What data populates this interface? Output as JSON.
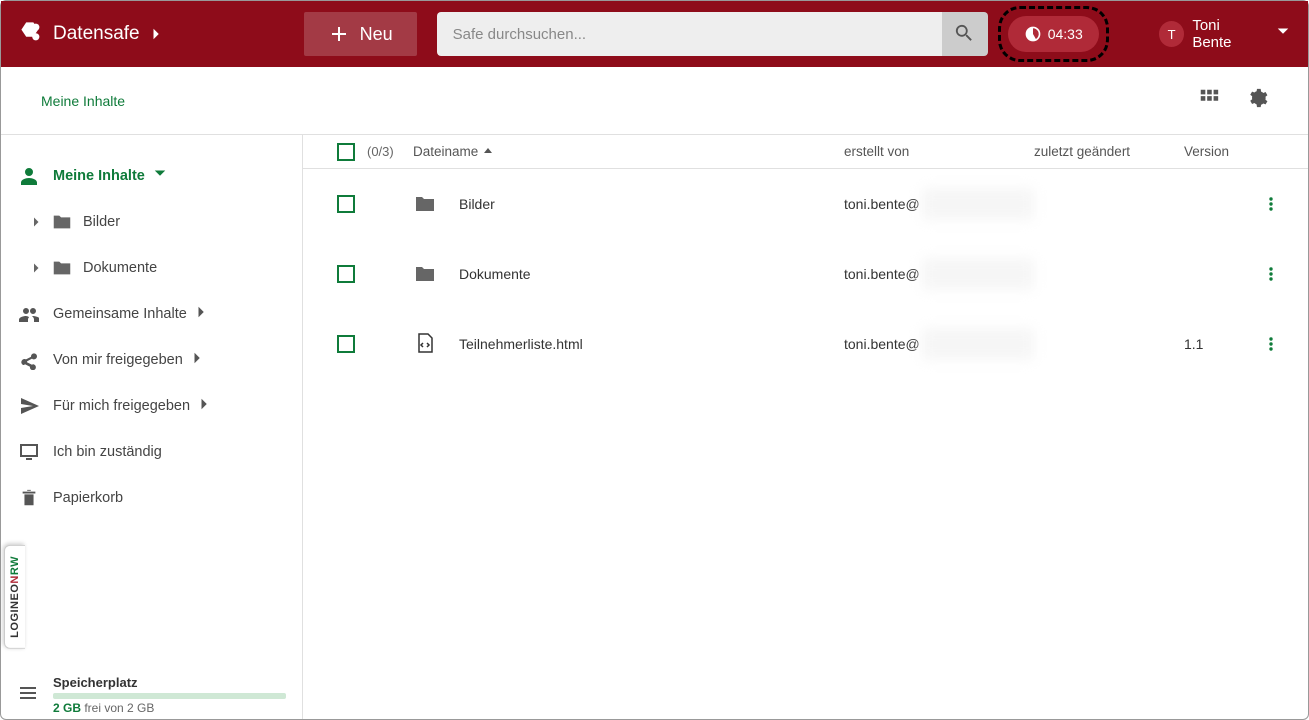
{
  "header": {
    "app_title": "Datensafe",
    "neu_label": "Neu",
    "search_placeholder": "Safe durchsuchen...",
    "timer": "04:33",
    "user_initial": "T",
    "user_name": "Toni Bente"
  },
  "breadcrumb": {
    "text": "Meine Inhalte"
  },
  "sidebar": {
    "my_content": "Meine Inhalte",
    "tree": [
      {
        "label": "Bilder"
      },
      {
        "label": "Dokumente"
      }
    ],
    "shared": "Gemeinsame Inhalte",
    "shared_by_me": "Von mir freigegeben",
    "shared_with_me": "Für mich freigegeben",
    "responsible": "Ich bin zuständig",
    "trash": "Papierkorb",
    "storage_title": "Speicherplatz",
    "storage_free_val": "2 GB",
    "storage_free_rest": " frei von 2 GB",
    "logineo_1": "LOGINEO",
    "logineo_2": "N",
    "logineo_3": "RW"
  },
  "list": {
    "count": "(0/3)",
    "col_name": "Dateiname",
    "col_created": "erstellt von",
    "col_modified": "zuletzt geändert",
    "col_version": "Version",
    "rows": [
      {
        "name": "Bilder",
        "type": "folder",
        "created": "toni.bente@",
        "version": ""
      },
      {
        "name": "Dokumente",
        "type": "folder",
        "created": "toni.bente@",
        "version": ""
      },
      {
        "name": "Teilnehmerliste.html",
        "type": "html",
        "created": "toni.bente@",
        "version": "1.1"
      }
    ]
  }
}
